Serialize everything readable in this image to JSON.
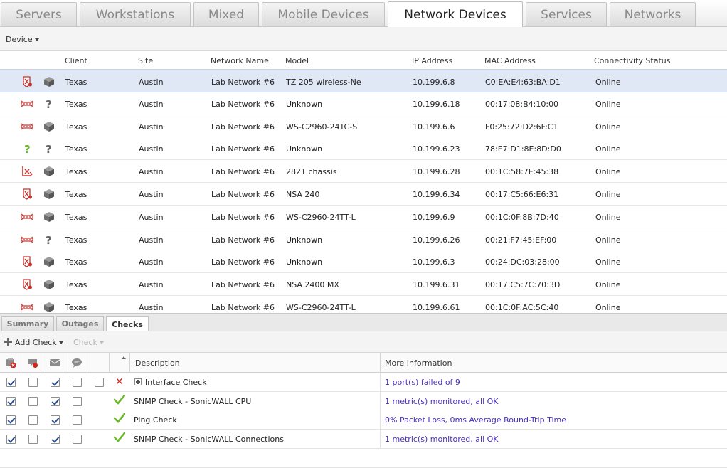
{
  "top_tabs": [
    {
      "label": "Servers"
    },
    {
      "label": "Workstations"
    },
    {
      "label": "Mixed"
    },
    {
      "label": "Mobile Devices"
    },
    {
      "label": "Network Devices",
      "active": true
    },
    {
      "label": "Services"
    },
    {
      "label": "Networks"
    }
  ],
  "device_menu": {
    "label": "Device"
  },
  "grid": {
    "columns": {
      "client": "Client",
      "site": "Site",
      "network_name": "Network Name",
      "model": "Model",
      "ip_address": "IP Address",
      "mac_address": "MAC Address",
      "connectivity_status": "Connectivity Status"
    },
    "rows": [
      {
        "icon1": "firewall-icon",
        "icon2": "box-icon",
        "client": "Texas",
        "site": "Austin",
        "network_name": "Lab Network #6",
        "model": "TZ 205 wireless-Ne",
        "ip": "10.199.6.8",
        "mac": "C0:EA:E4:63:BA:D1",
        "status": "Online",
        "selected": true
      },
      {
        "icon1": "switch-icon",
        "icon2": "unknown-icon",
        "client": "Texas",
        "site": "Austin",
        "network_name": "Lab Network #6",
        "model": "Unknown",
        "ip": "10.199.6.18",
        "mac": "00:17:08:B4:10:00",
        "status": "Online"
      },
      {
        "icon1": "switch-icon",
        "icon2": "box-icon",
        "client": "Texas",
        "site": "Austin",
        "network_name": "Lab Network #6",
        "model": "WS-C2960-24TC-S",
        "ip": "10.199.6.6",
        "mac": "F0:25:72:D2:6F:C1",
        "status": "Online"
      },
      {
        "icon1": "question-icon",
        "icon2": "unknown-icon",
        "client": "Texas",
        "site": "Austin",
        "network_name": "Lab Network #6",
        "model": "Unknown",
        "ip": "10.199.6.23",
        "mac": "78:E7:D1:8E:8D:D0",
        "status": "Online"
      },
      {
        "icon1": "router-icon",
        "icon2": "box-icon",
        "client": "Texas",
        "site": "Austin",
        "network_name": "Lab Network #6",
        "model": "2821 chassis",
        "ip": "10.199.6.28",
        "mac": "00:1C:58:7E:45:38",
        "status": "Online"
      },
      {
        "icon1": "firewall-icon",
        "icon2": "box-icon",
        "client": "Texas",
        "site": "Austin",
        "network_name": "Lab Network #6",
        "model": "NSA 240",
        "ip": "10.199.6.34",
        "mac": "00:17:C5:66:E6:31",
        "status": "Online"
      },
      {
        "icon1": "switch-icon",
        "icon2": "box-icon",
        "client": "Texas",
        "site": "Austin",
        "network_name": "Lab Network #6",
        "model": "WS-C2960-24TT-L",
        "ip": "10.199.6.9",
        "mac": "00:1C:0F:8B:7D:40",
        "status": "Online"
      },
      {
        "icon1": "switch-icon",
        "icon2": "unknown-icon",
        "client": "Texas",
        "site": "Austin",
        "network_name": "Lab Network #6",
        "model": "Unknown",
        "ip": "10.199.6.26",
        "mac": "00:21:F7:45:EF:00",
        "status": "Online"
      },
      {
        "icon1": "firewall-icon",
        "icon2": "box-icon",
        "client": "Texas",
        "site": "Austin",
        "network_name": "Lab Network #6",
        "model": "Unknown",
        "ip": "10.199.6.3",
        "mac": "00:24:DC:03:28:00",
        "status": "Online"
      },
      {
        "icon1": "firewall-icon",
        "icon2": "box-icon",
        "client": "Texas",
        "site": "Austin",
        "network_name": "Lab Network #6",
        "model": "NSA 2400 MX",
        "ip": "10.199.6.31",
        "mac": "00:17:C5:7C:70:3D",
        "status": "Online"
      },
      {
        "icon1": "switch-icon",
        "icon2": "box-icon",
        "client": "Texas",
        "site": "Austin",
        "network_name": "Lab Network #6",
        "model": "WS-C2960-24TT-L",
        "ip": "10.199.6.61",
        "mac": "00:1C:0F:AC:5C:40",
        "status": "Online"
      }
    ]
  },
  "bottom_tabs": [
    {
      "label": "Summary"
    },
    {
      "label": "Outages"
    },
    {
      "label": "Checks",
      "active": true
    }
  ],
  "checks_toolbar": {
    "add_check": "Add Check",
    "check_menu": "Check"
  },
  "checks_table": {
    "columns": {
      "description": "Description",
      "more_information": "More Information"
    },
    "header_icons": [
      "alert-icon",
      "ticket-icon",
      "email-icon",
      "comment-icon"
    ],
    "rows": [
      {
        "c1": true,
        "c2": false,
        "c3": true,
        "c4": false,
        "c5": false,
        "status": "fail",
        "expandable": true,
        "description": "Interface Check",
        "more": "1 port(s) failed of 9"
      },
      {
        "c1": true,
        "c2": false,
        "c3": true,
        "c4": false,
        "status": "ok",
        "description": "SNMP Check - SonicWALL CPU",
        "more": "1 metric(s) monitored, all OK"
      },
      {
        "c1": true,
        "c2": false,
        "c3": true,
        "c4": false,
        "status": "ok",
        "description": "Ping Check",
        "more": "0% Packet Loss, 0ms Average Round-Trip Time"
      },
      {
        "c1": true,
        "c2": false,
        "c3": true,
        "c4": false,
        "status": "ok",
        "description": "SNMP Check - SonicWALL Connections",
        "more": "1 metric(s) monitored, all OK"
      }
    ]
  },
  "colors": {
    "link": "#4b2fbf",
    "fail": "#d0261d",
    "ok": "#6ab82a",
    "selected_row": "#e1e8f5"
  }
}
